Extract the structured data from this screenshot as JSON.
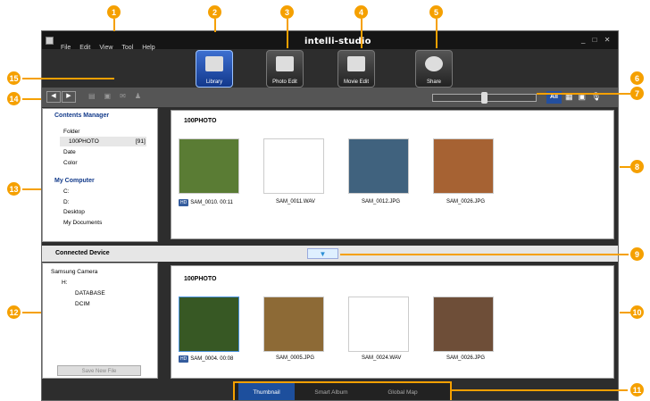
{
  "window": {
    "title": "intelli-studio",
    "controls": "_ □ ✕"
  },
  "menu": [
    "File",
    "Edit",
    "View",
    "Tool",
    "Help"
  ],
  "top_buttons": [
    "Library",
    "Photo Edit",
    "Movie Edit",
    "Share"
  ],
  "filter_buttons": [
    "All"
  ],
  "contents_manager": {
    "title": "Contents Manager",
    "items": [
      "Folder",
      "100PHOTO",
      "[91]",
      "Date",
      "Color"
    ]
  },
  "my_computer": {
    "title": "My Computer",
    "items": [
      "C:",
      "D:",
      "Desktop",
      "My Documents"
    ]
  },
  "connected_device": {
    "title": "Connected Device",
    "tree": [
      "Samsung Camera",
      "H:",
      "DATABASE",
      "DCIM"
    ],
    "save_label": "Save New File"
  },
  "library": {
    "folder": "100PHOTO",
    "items": [
      {
        "badge": "HD",
        "name": "SAM_0010.",
        "time": "00:11"
      },
      {
        "name": "SAM_0011.WAV"
      },
      {
        "name": "SAM_0012.JPG"
      },
      {
        "name": "SAM_0026.JPG"
      }
    ]
  },
  "device_view": {
    "folder": "100PHOTO",
    "items": [
      {
        "badge": "HD",
        "name": "SAM_0004.",
        "time": "00:08"
      },
      {
        "name": "SAM_0005.JPG"
      },
      {
        "name": "SAM_0024.WAV"
      },
      {
        "name": "SAM_0026.JPG"
      }
    ]
  },
  "bottom_tabs": [
    "Thumbnail",
    "Smart Album",
    "Global Map"
  ],
  "callouts": [
    "1",
    "2",
    "3",
    "4",
    "5",
    "6",
    "7",
    "8",
    "9",
    "10",
    "11",
    "12",
    "13",
    "14",
    "15"
  ],
  "colors": {
    "accent": "#f5a000",
    "selected": "#2a5ac8"
  }
}
